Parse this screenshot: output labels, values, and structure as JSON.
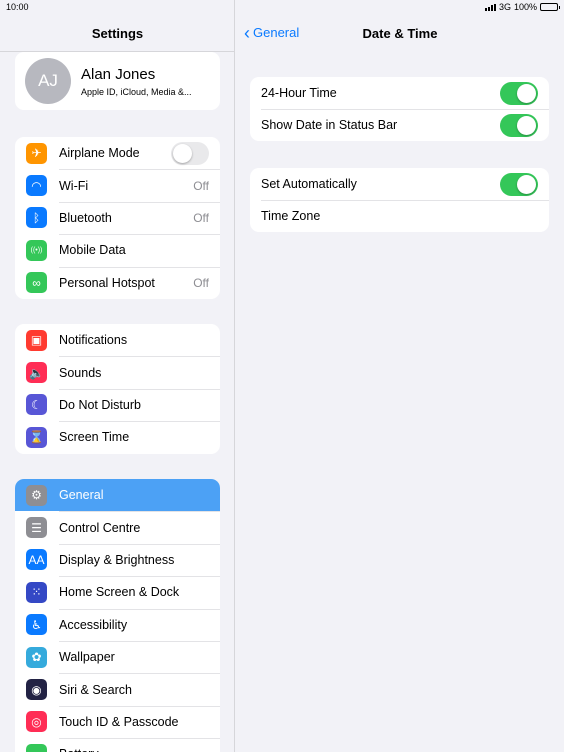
{
  "status": {
    "time": "10:00",
    "network": "3G",
    "battery": "100%"
  },
  "left": {
    "title": "Settings",
    "profile": {
      "initials": "AJ",
      "name": "Alan Jones",
      "subtitle": "Apple ID, iCloud, Media &..."
    },
    "group1": [
      {
        "label": "Airplane Mode",
        "icon": "airplane-icon",
        "color": "#ff9500",
        "glyph": "✈",
        "toggle": false
      },
      {
        "label": "Wi-Fi",
        "icon": "wifi-icon",
        "color": "#0a7aff",
        "glyph": "◠",
        "value": "Off"
      },
      {
        "label": "Bluetooth",
        "icon": "bluetooth-icon",
        "color": "#0a7aff",
        "glyph": "ᛒ",
        "value": "Off"
      },
      {
        "label": "Mobile Data",
        "icon": "antenna-icon",
        "color": "#34c759",
        "glyph": "((•))"
      },
      {
        "label": "Personal Hotspot",
        "icon": "hotspot-icon",
        "color": "#34c759",
        "glyph": "∞",
        "value": "Off"
      }
    ],
    "group2": [
      {
        "label": "Notifications",
        "icon": "notifications-icon",
        "color": "#ff3b30",
        "glyph": "▣"
      },
      {
        "label": "Sounds",
        "icon": "speaker-icon",
        "color": "#ff2d55",
        "glyph": "🔈"
      },
      {
        "label": "Do Not Disturb",
        "icon": "moon-icon",
        "color": "#5856d6",
        "glyph": "☾"
      },
      {
        "label": "Screen Time",
        "icon": "hourglass-icon",
        "color": "#5856d6",
        "glyph": "⌛"
      }
    ],
    "group3": [
      {
        "label": "General",
        "icon": "gear-icon",
        "color": "#8e8e93",
        "glyph": "⚙",
        "active": true
      },
      {
        "label": "Control Centre",
        "icon": "toggles-icon",
        "color": "#8e8e93",
        "glyph": "☰"
      },
      {
        "label": "Display & Brightness",
        "icon": "display-icon",
        "color": "#0a7aff",
        "glyph": "AA"
      },
      {
        "label": "Home Screen & Dock",
        "icon": "grid-icon",
        "color": "#3448c5",
        "glyph": "⁙"
      },
      {
        "label": "Accessibility",
        "icon": "accessibility-icon",
        "color": "#0a7aff",
        "glyph": "♿"
      },
      {
        "label": "Wallpaper",
        "icon": "flower-icon",
        "color": "#35aadc",
        "glyph": "✿"
      },
      {
        "label": "Siri & Search",
        "icon": "siri-icon",
        "color": "#222244",
        "glyph": "◉"
      },
      {
        "label": "Touch ID & Passcode",
        "icon": "fingerprint-icon",
        "color": "#ff2d55",
        "glyph": "◎"
      },
      {
        "label": "Battery",
        "icon": "battery-icon",
        "color": "#34c759",
        "glyph": "▬"
      }
    ]
  },
  "right": {
    "back_label": "General",
    "title": "Date & Time",
    "group1": [
      {
        "label": "24-Hour Time",
        "toggle": true
      },
      {
        "label": "Show Date in Status Bar",
        "toggle": true
      }
    ],
    "group2": [
      {
        "label": "Set Automatically",
        "toggle": true
      },
      {
        "label": "Time Zone"
      }
    ]
  }
}
